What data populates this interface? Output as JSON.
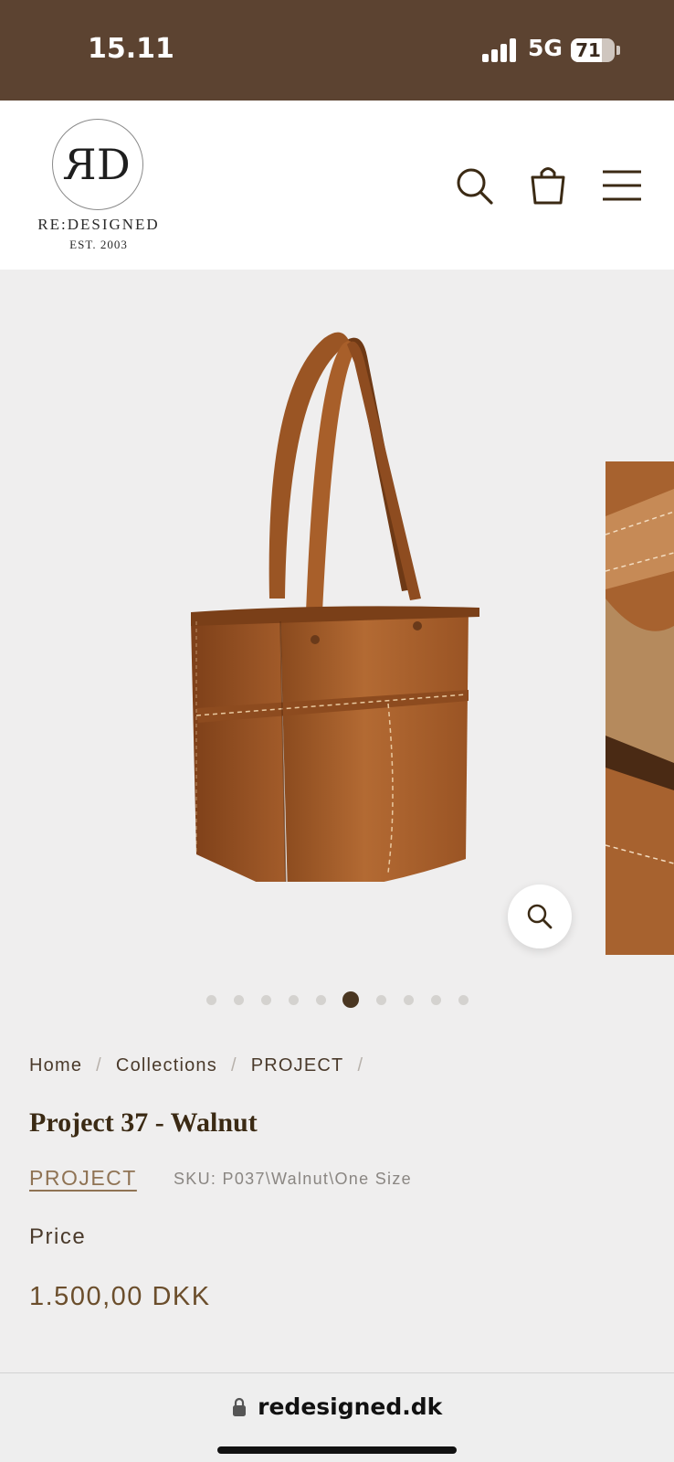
{
  "status_bar": {
    "time": "15.11",
    "network": "5G",
    "battery": "71",
    "battery_level": 0.71,
    "signal_bars": 4
  },
  "header": {
    "logo_monogram": "RD",
    "logo_name": "RE:DESIGNED",
    "logo_est": "EST. 2003",
    "icons": [
      "search-icon",
      "bag-icon",
      "menu-icon"
    ]
  },
  "gallery": {
    "image_count": 10,
    "active_index": 5
  },
  "breadcrumb": {
    "items": [
      "Home",
      "Collections",
      "PROJECT"
    ],
    "separator": "/"
  },
  "product": {
    "title": "Project 37 - Walnut",
    "vendor": "PROJECT",
    "sku": "SKU: P037\\Walnut\\One Size",
    "price_label": "Price",
    "price": "1.500,00 DKK"
  },
  "browser": {
    "url": "redesigned.dk"
  },
  "colors": {
    "status_bar": "#5c4331",
    "accent": "#6b4e2c",
    "leather": "#a8622c"
  }
}
